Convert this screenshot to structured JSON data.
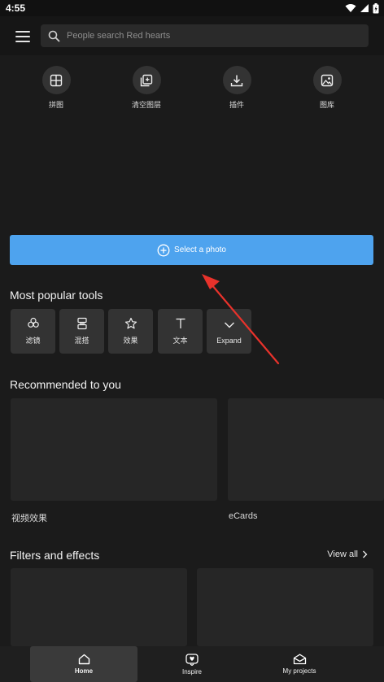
{
  "status_bar": {
    "time": "4:55"
  },
  "search": {
    "placeholder": "People search Red hearts"
  },
  "quick_actions": [
    {
      "icon": "collage-icon",
      "label": "拼图"
    },
    {
      "icon": "clear-layers-icon",
      "label": "清空图层"
    },
    {
      "icon": "download-icon",
      "label": "插件"
    },
    {
      "icon": "gallery-icon",
      "label": "图库"
    }
  ],
  "select_photo": {
    "label": "Select a photo"
  },
  "popular_tools": {
    "title": "Most popular tools",
    "items": [
      {
        "icon": "filter-icon",
        "label": "滤镜"
      },
      {
        "icon": "blend-icon",
        "label": "混搭"
      },
      {
        "icon": "star-icon",
        "label": "效果"
      },
      {
        "icon": "text-icon",
        "label": "文本"
      },
      {
        "icon": "chevron-down-icon",
        "label": "Expand"
      }
    ]
  },
  "recommended": {
    "title": "Recommended to you",
    "items": [
      {
        "label": "视频效果"
      },
      {
        "label": "eCards"
      }
    ]
  },
  "filters": {
    "title": "Filters and effects",
    "view_all": "View all"
  },
  "bottom_nav": [
    {
      "icon": "home-icon",
      "label": "Home",
      "active": true
    },
    {
      "icon": "inspire-icon",
      "label": "Inspire",
      "active": false
    },
    {
      "icon": "projects-icon",
      "label": "My projects",
      "active": false
    }
  ],
  "colors": {
    "accent": "#4ea3ee",
    "background": "#1b1b1b",
    "tile": "#333333",
    "annotation_arrow": "#e8322b"
  }
}
